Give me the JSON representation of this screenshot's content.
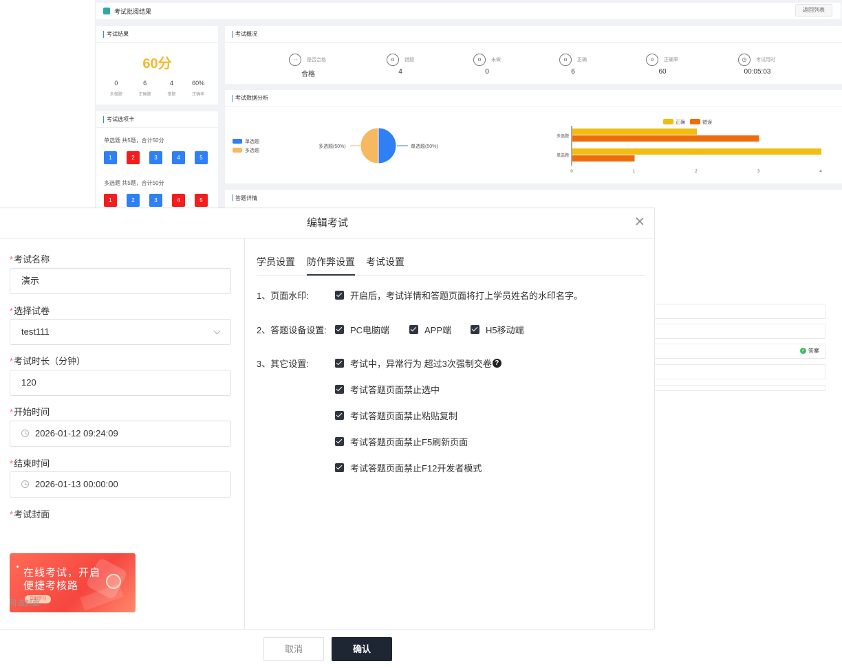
{
  "background": {
    "header_title": "考试批阅结果",
    "back_button": "返回列表",
    "result_card": {
      "title": "考试结果",
      "score": "60分",
      "stats": [
        {
          "value": "0",
          "label": "未做题"
        },
        {
          "value": "6",
          "label": "正确题"
        },
        {
          "value": "4",
          "label": "错题"
        },
        {
          "value": "60%",
          "label": "正确率"
        }
      ]
    },
    "overview_card": {
      "title": "考试概况",
      "items": [
        {
          "label": "是否合格",
          "value": "合格",
          "icon": "face-smile-icon"
        },
        {
          "label": "错题",
          "value": "4",
          "icon": "face-o-icon"
        },
        {
          "label": "未做",
          "value": "0",
          "icon": "face-o-icon"
        },
        {
          "label": "正确",
          "value": "6",
          "icon": "face-o-icon"
        },
        {
          "label": "正确率",
          "value": "60",
          "icon": "face-o-icon"
        },
        {
          "label": "考试用时",
          "value": "00:05:03",
          "icon": "clock-icon"
        }
      ]
    },
    "answer_card": {
      "title": "考试选项卡",
      "single_head": "单选题 共5题，合计50分",
      "single": [
        {
          "n": "1",
          "color": "blue"
        },
        {
          "n": "2",
          "color": "red"
        },
        {
          "n": "3",
          "color": "blue"
        },
        {
          "n": "4",
          "color": "blue"
        },
        {
          "n": "5",
          "color": "blue"
        }
      ],
      "multi_head": "多选题 共5题，合计50分",
      "multi": [
        {
          "n": "1",
          "color": "red"
        },
        {
          "n": "2",
          "color": "blue"
        },
        {
          "n": "3",
          "color": "blue"
        },
        {
          "n": "4",
          "color": "red"
        },
        {
          "n": "5",
          "color": "red"
        }
      ]
    },
    "analysis_card": {
      "title": "考试数据分析",
      "pie_legend": [
        "单选题",
        "多选题"
      ],
      "pie_labels": {
        "left": "多选题(50%)",
        "right": "单选题(50%)"
      },
      "bar_legend": [
        "正确",
        "错误"
      ],
      "bar_categories": [
        "多选题",
        "单选题"
      ],
      "bar_ticks": [
        "0",
        "1",
        "2",
        "3",
        "4"
      ]
    },
    "detail_card_title": "答题详情",
    "answer_badge": "答案"
  },
  "chart_data": [
    {
      "type": "pie",
      "labels": [
        "单选题",
        "多选题"
      ],
      "values": [
        50,
        50
      ],
      "colors": [
        "#2f7ff6",
        "#f6b860"
      ]
    },
    {
      "type": "bar",
      "orientation": "horizontal",
      "categories": [
        "多选题",
        "单选题"
      ],
      "series": [
        {
          "name": "正确",
          "values": [
            2,
            4
          ],
          "color": "#f2bd11"
        },
        {
          "name": "错误",
          "values": [
            3,
            1
          ],
          "color": "#ef6c0c"
        }
      ],
      "xlim": [
        0,
        4
      ],
      "legend": "top-center"
    }
  ],
  "modal": {
    "title": "编辑考试",
    "fields": {
      "name_label": "考试名称",
      "name_value": "演示",
      "paper_label": "选择试卷",
      "paper_value": "test111",
      "duration_label": "考试时长（分钟）",
      "duration_value": "120",
      "start_label": "开始时间",
      "start_value": "2026-01-12 09:24:09",
      "end_label": "结束时间",
      "end_value": "2026-01-13 00:00:00",
      "cover_label": "考试封面",
      "cover_line1": "在线考试，开启",
      "cover_line2": "便捷考核路",
      "cover_pill": "立即学习",
      "optional_cover_label": "可选封面"
    },
    "tabs": [
      "学员设置",
      "防作弊设置",
      "考试设置"
    ],
    "active_tab": "防作弊设置",
    "settings": {
      "watermark_label": "1、页面水印:",
      "watermark_option": "开启后，考试详情和答题页面将打上学员姓名的水印名字。",
      "device_label": "2、答题设备设置:",
      "device_options": [
        "PC电脑端",
        "APP端",
        "H5移动端"
      ],
      "other_label": "3、其它设置:",
      "other_options": [
        "考试中，异常行为 超过3次强制交卷",
        "考试答题页面禁止选中",
        "考试答题页面禁止粘贴复制",
        "考试答题页面禁止F5刷新页面",
        "考试答题页面禁止F12开发者模式"
      ]
    },
    "buttons": {
      "cancel": "取消",
      "confirm": "确认"
    }
  }
}
